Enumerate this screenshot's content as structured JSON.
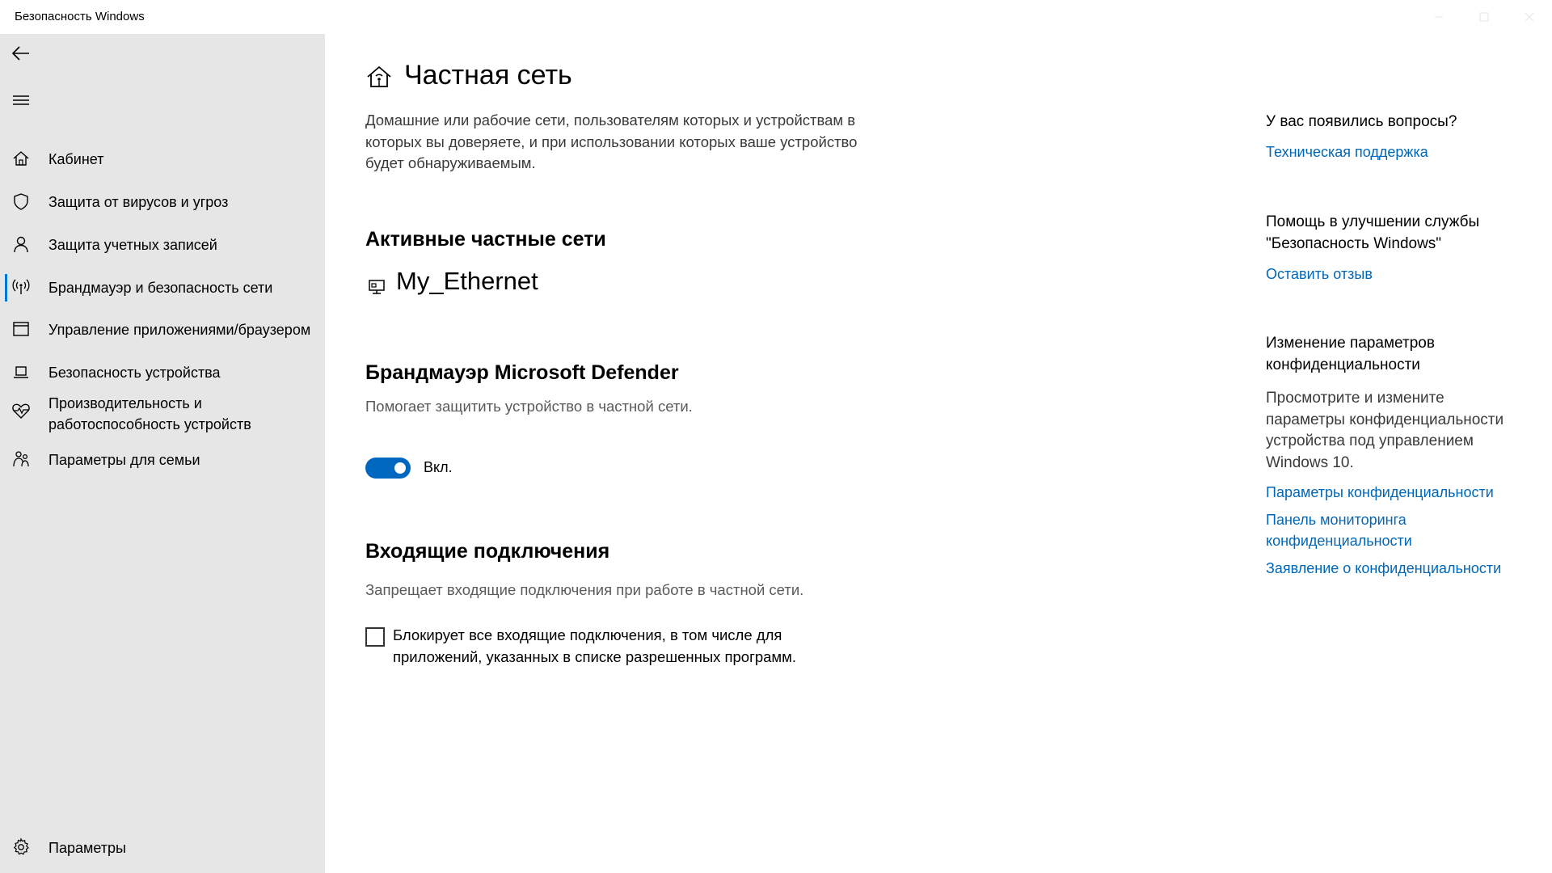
{
  "window": {
    "title": "Безопасность Windows"
  },
  "sidebar": {
    "items": [
      {
        "label": "Кабинет",
        "icon": "home-icon"
      },
      {
        "label": "Защита от вирусов и угроз",
        "icon": "shield-icon"
      },
      {
        "label": "Защита учетных записей",
        "icon": "person-icon"
      },
      {
        "label": "Брандмауэр и безопасность сети",
        "icon": "antenna-icon",
        "active": true
      },
      {
        "label": "Управление приложениями/браузером",
        "icon": "browser-window-icon"
      },
      {
        "label": "Безопасность устройства",
        "icon": "laptop-icon"
      },
      {
        "label": "Производительность и работоспособность устройств",
        "label_line1": "Производительность и",
        "label_line2": "работоспособность устройств",
        "icon": "heart-pulse-icon"
      },
      {
        "label": "Параметры для семьи",
        "icon": "family-icon"
      }
    ],
    "settings_label": "Параметры"
  },
  "main": {
    "title": "Частная сеть",
    "description": "Домашние или рабочие сети, пользователям которых и устройствам в которых вы доверяете, и при использовании которых ваше устройство будет обнаруживаемым.",
    "active_networks_heading": "Активные частные сети",
    "network_name": "My_Ethernet",
    "firewall_heading": "Брандмауэр Microsoft Defender",
    "firewall_description": "Помогает защитить устройство в частной сети.",
    "firewall_toggle_label": "Вкл.",
    "firewall_enabled": true,
    "incoming_heading": "Входящие подключения",
    "incoming_description": "Запрещает входящие подключения при работе в частной сети.",
    "block_all_label": "Блокирует все входящие подключения, в том числе для приложений, указанных в списке разрешенных программ.",
    "block_all_checked": false
  },
  "right_panel": {
    "questions_heading": "У вас появились вопросы?",
    "support_link": "Техническая поддержка",
    "improve_heading": "Помощь в улучшении службы \"Безопасность Windows\"",
    "feedback_link": "Оставить отзыв",
    "privacy_heading": "Изменение параметров конфиденциальности",
    "privacy_text": "Просмотрите и измените параметры конфиденциальности устройства под управлением Windows 10.",
    "privacy_settings_link": "Параметры конфиденциальности",
    "privacy_dashboard_link": "Панель мониторинга конфиденциальности",
    "privacy_statement_link": "Заявление о конфиденциальности"
  },
  "colors": {
    "accent": "#0067c0",
    "link": "#0067b8",
    "sidebar_bg": "#e6e6e6"
  }
}
